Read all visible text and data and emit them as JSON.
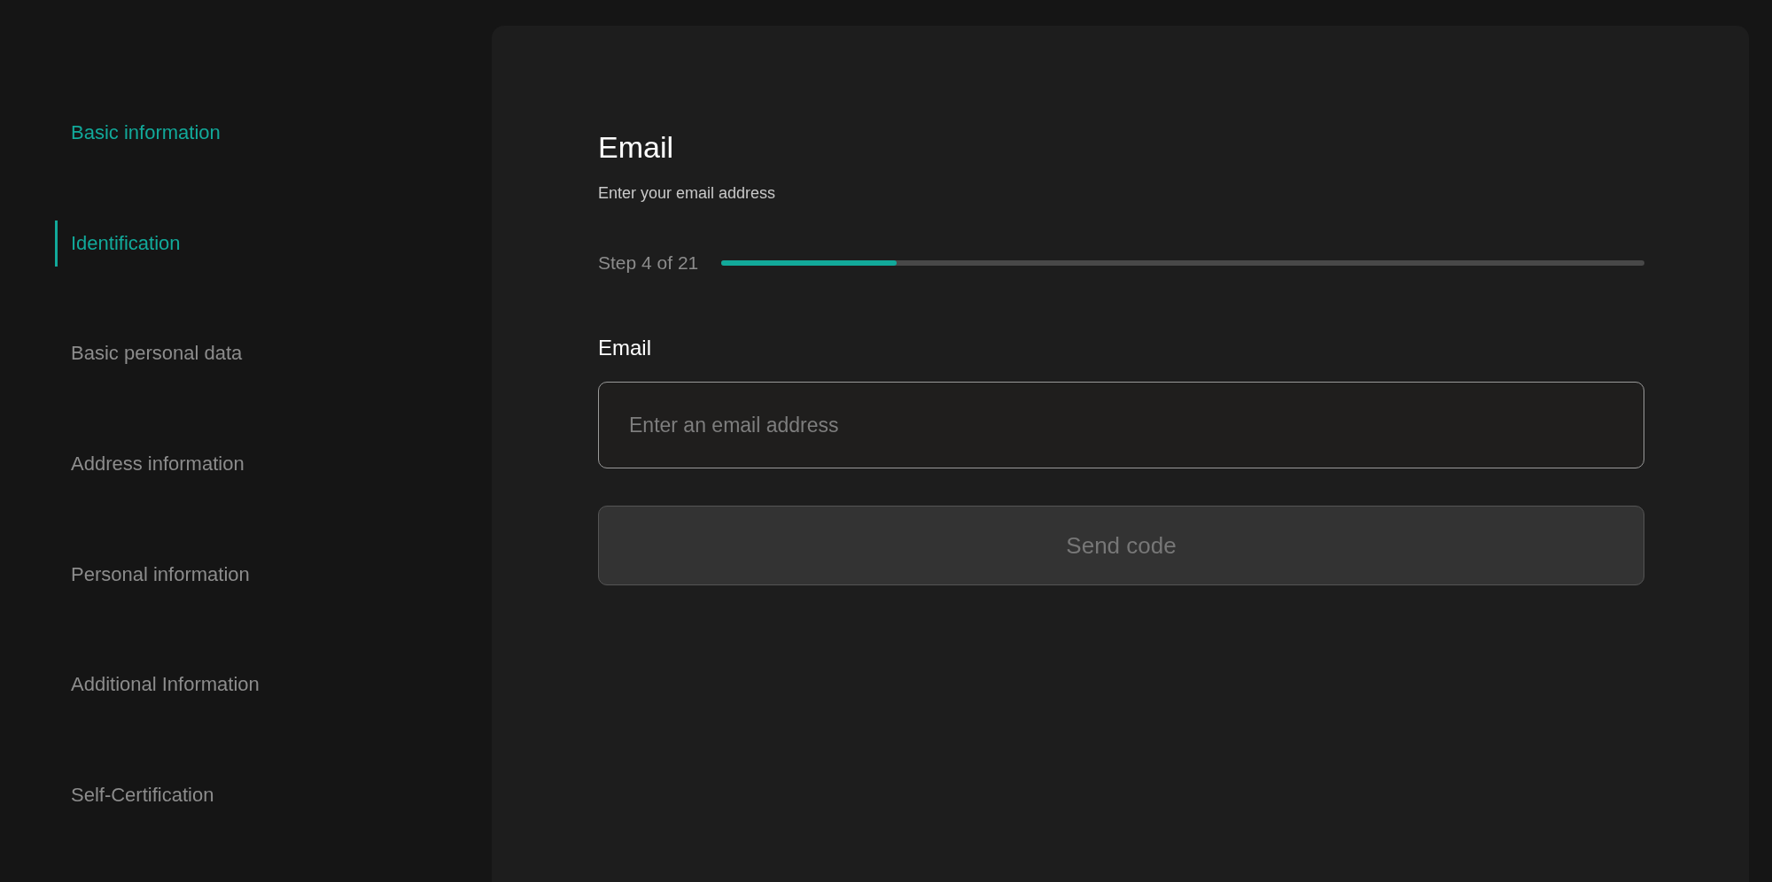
{
  "sidebar": {
    "items": [
      {
        "label": "Basic information",
        "highlighted": true,
        "selected": false
      },
      {
        "label": "Identification",
        "highlighted": true,
        "selected": true
      },
      {
        "label": "Basic personal data",
        "highlighted": false,
        "selected": false
      },
      {
        "label": "Address information",
        "highlighted": false,
        "selected": false
      },
      {
        "label": "Personal information",
        "highlighted": false,
        "selected": false
      },
      {
        "label": "Additional Information",
        "highlighted": false,
        "selected": false
      },
      {
        "label": "Self-Certification",
        "highlighted": false,
        "selected": false
      }
    ]
  },
  "form": {
    "title": "Email",
    "subtitle": "Enter your email address",
    "progress": {
      "label": "Step 4 of 21",
      "level": 0.19
    },
    "field": {
      "label": "Email",
      "placeholder": "Enter an email address"
    },
    "button": {
      "label": "Send code",
      "disabled": true
    }
  }
}
